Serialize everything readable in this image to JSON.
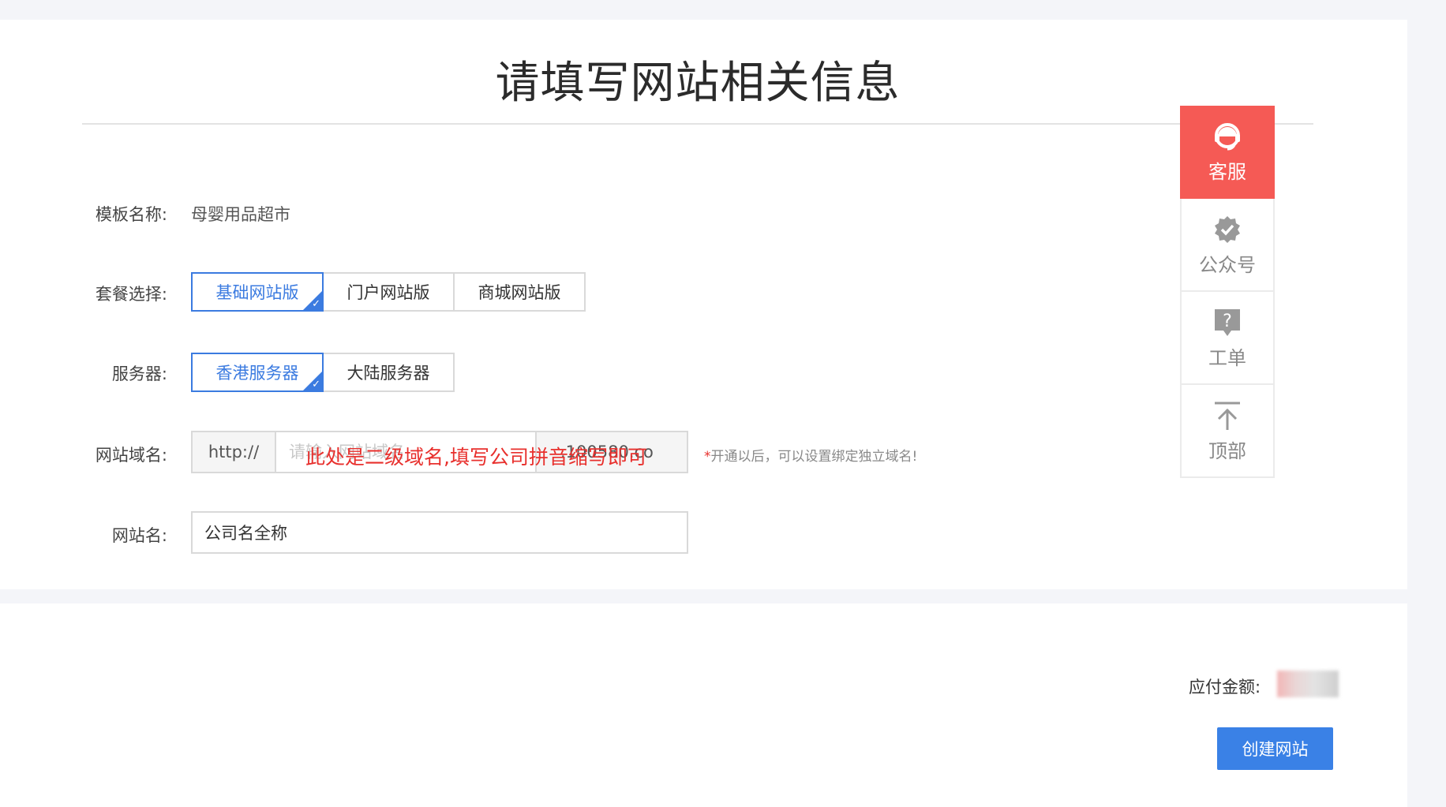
{
  "page_title": "请填写网站相关信息",
  "template": {
    "label": "模板名称:",
    "value": "母婴用品超市"
  },
  "package": {
    "label": "套餐选择:",
    "options": [
      "基础网站版",
      "门户网站版",
      "商城网站版"
    ],
    "selected": "基础网站版"
  },
  "server": {
    "label": "服务器:",
    "options": [
      "香港服务器",
      "大陆服务器"
    ],
    "selected": "香港服务器"
  },
  "domain": {
    "label": "网站域名:",
    "prefix": "http://",
    "placeholder": "请输入网站域名",
    "suffix": ".100580.co",
    "overlay_note": "此处是二级域名,填写公司拼音缩写即可",
    "hint_star": "*",
    "hint": "开通以后，可以设置绑定独立域名!"
  },
  "site_name": {
    "label": "网站名:",
    "value": "公司名全称"
  },
  "sidebar": {
    "items": [
      {
        "label": "客服",
        "icon": "headset-icon"
      },
      {
        "label": "公众号",
        "icon": "verified-badge-icon"
      },
      {
        "label": "工单",
        "icon": "question-ticket-icon"
      },
      {
        "label": "顶部",
        "icon": "back-to-top-icon"
      }
    ]
  },
  "payment": {
    "label": "应付金额:"
  },
  "create_button": "创建网站",
  "colors": {
    "primary": "#3a81e6",
    "service": "#f55a55",
    "warning": "#e8302d"
  }
}
